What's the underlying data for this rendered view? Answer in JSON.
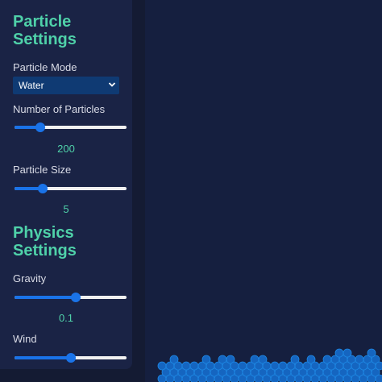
{
  "sections": {
    "particle": {
      "title_line1": "Particle",
      "title_line2": "Settings"
    },
    "physics": {
      "title_line1": "Physics",
      "title_line2": "Settings"
    }
  },
  "controls": {
    "mode": {
      "label": "Particle Mode",
      "selected": "Water"
    },
    "count": {
      "label": "Number of Particles",
      "value": "200",
      "level": 0.23
    },
    "size": {
      "label": "Particle Size",
      "value": "5",
      "level": 0.25
    },
    "gravity": {
      "label": "Gravity",
      "value": "0.1",
      "level": 0.55
    },
    "wind": {
      "label": "Wind",
      "level": 0.5
    }
  },
  "colors": {
    "accent": "#4fd1a9",
    "slider": "#1a73e8",
    "particle": "#1565c0",
    "particle_edge": "#1e88e5"
  }
}
